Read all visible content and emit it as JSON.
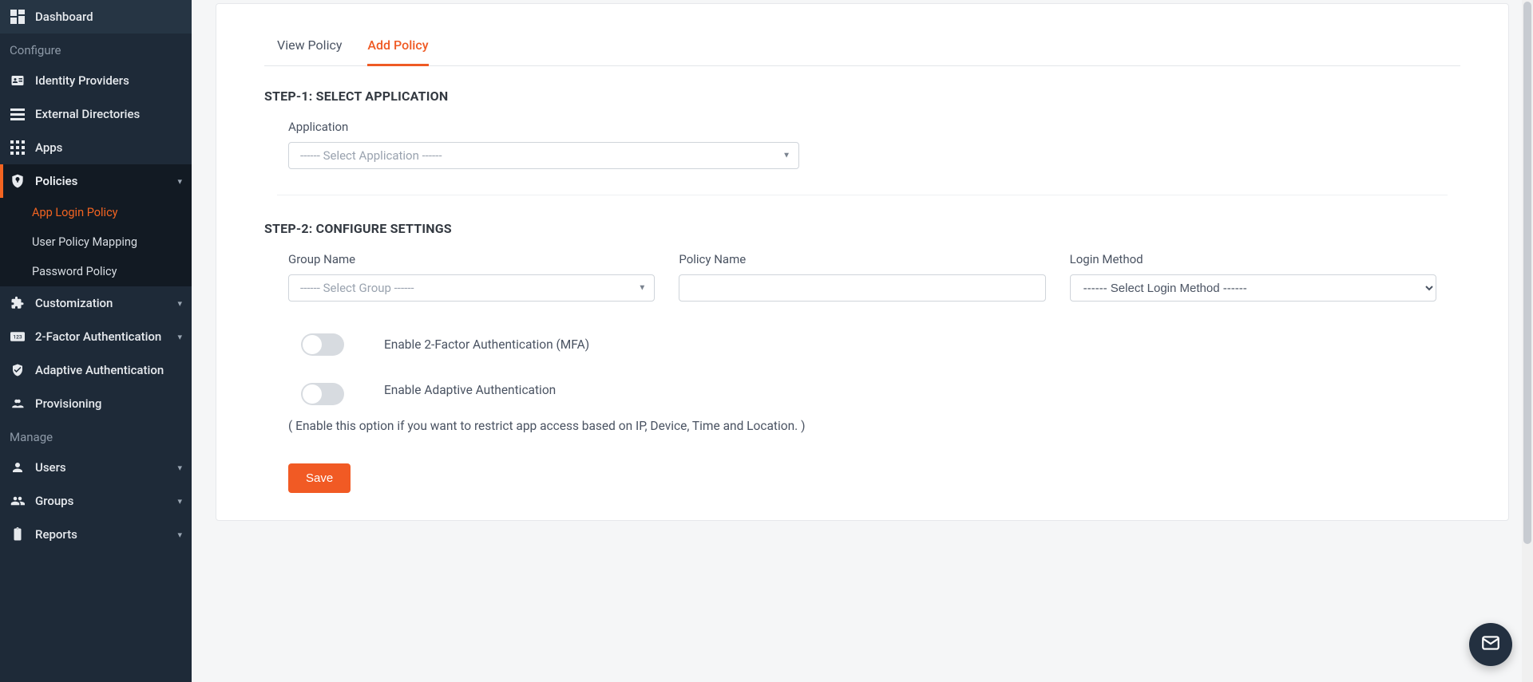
{
  "sidebar": {
    "sections": {
      "configure_label": "Configure",
      "manage_label": "Manage"
    },
    "dashboard": "Dashboard",
    "identity_providers": "Identity Providers",
    "external_directories": "External Directories",
    "apps": "Apps",
    "policies": "Policies",
    "policies_sub": {
      "app_login_policy": "App Login Policy",
      "user_policy_mapping": "User Policy Mapping",
      "password_policy": "Password Policy"
    },
    "customization": "Customization",
    "two_factor": "2-Factor Authentication",
    "adaptive_auth": "Adaptive Authentication",
    "provisioning": "Provisioning",
    "users": "Users",
    "groups": "Groups",
    "reports": "Reports"
  },
  "tabs": {
    "view_policy": "View Policy",
    "add_policy": "Add Policy"
  },
  "step1": {
    "title": "STEP-1: SELECT APPLICATION",
    "application_label": "Application",
    "application_placeholder": "------ Select Application ------"
  },
  "step2": {
    "title": "STEP-2: CONFIGURE SETTINGS",
    "group_label": "Group Name",
    "group_placeholder": "------ Select Group ------",
    "policy_label": "Policy Name",
    "login_method_label": "Login Method",
    "login_method_placeholder": "------ Select Login Method ------",
    "toggle_mfa_label": "Enable 2-Factor Authentication (MFA)",
    "toggle_adaptive_label": "Enable Adaptive Authentication",
    "toggle_adaptive_help": "( Enable this option if you want to restrict app access based on IP, Device, Time and Location. )"
  },
  "buttons": {
    "save": "Save"
  }
}
